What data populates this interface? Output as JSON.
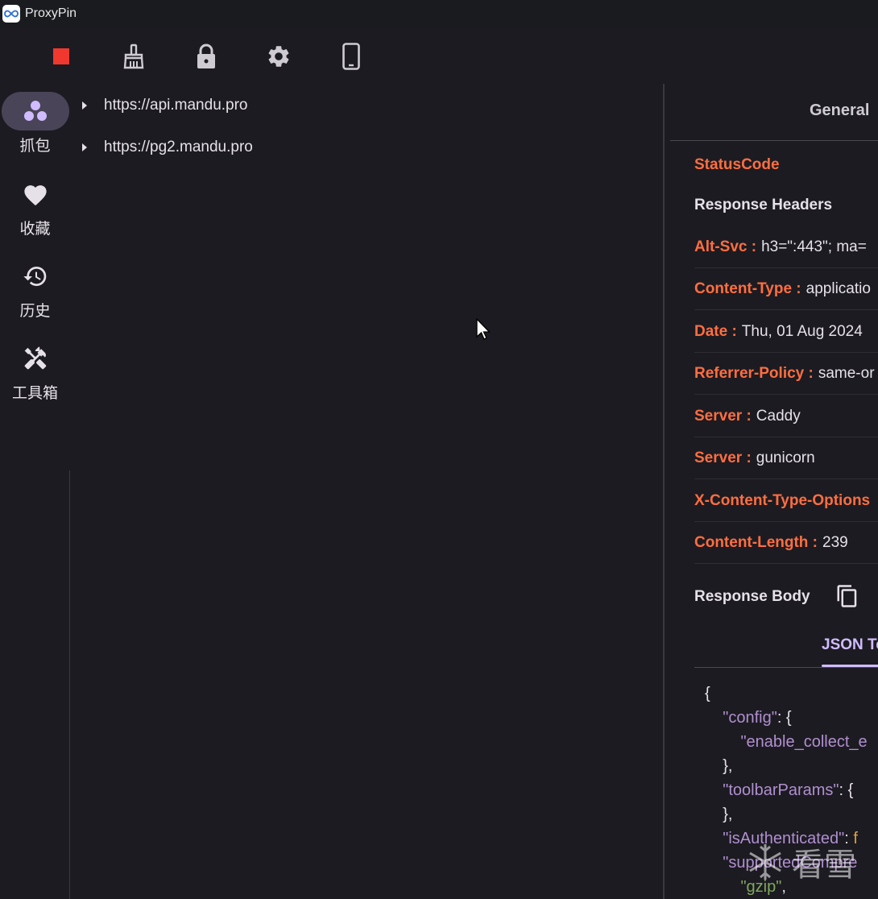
{
  "app": {
    "title": "ProxyPin"
  },
  "toolbar": {
    "icons": [
      "stop-icon",
      "clean-icon",
      "lock-icon",
      "gear-icon",
      "phone-icon"
    ],
    "stop_color": "#f1382f"
  },
  "nav": {
    "items": [
      {
        "label": "抓包",
        "icon": "capture-icon",
        "active": true
      },
      {
        "label": "收藏",
        "icon": "heart-icon",
        "active": false
      },
      {
        "label": "历史",
        "icon": "history-icon",
        "active": false
      },
      {
        "label": "工具箱",
        "icon": "tools-icon",
        "active": false
      }
    ]
  },
  "domains": [
    {
      "url": "https://api.mandu.pro"
    },
    {
      "url": "https://pg2.mandu.pro"
    }
  ],
  "detail": {
    "tab_general": "General",
    "status_code_label": "StatusCode",
    "response_headers_title": "Response Headers",
    "headers": [
      {
        "key": "Alt-Svc :",
        "value": "h3=\":443\"; ma="
      },
      {
        "key": "Content-Type :",
        "value": "applicatio"
      },
      {
        "key": "Date :",
        "value": "Thu, 01 Aug 2024"
      },
      {
        "key": "Referrer-Policy :",
        "value": "same-or"
      },
      {
        "key": "Server :",
        "value": "Caddy"
      },
      {
        "key": "Server :",
        "value": "gunicorn"
      },
      {
        "key": "X-Content-Type-Options",
        "value": ""
      },
      {
        "key": "Content-Length :",
        "value": "239"
      }
    ],
    "response_body_title": "Response Body",
    "json_tab": "JSON Te",
    "json_lines": {
      "l1": "{",
      "l2_key": "\"config\"",
      "l2_rest": ": {",
      "l3_key": "\"enable_collect_e",
      "l4": "},",
      "l5_key": "\"toolbarParams\"",
      "l5_rest": ": {",
      "l6": "},",
      "l7_key": "\"isAuthenticated\"",
      "l7_rest": ": ",
      "l7_val": "f",
      "l8_key": "\"supportedCompre",
      "l9_val": "\"gzip\"",
      "l9_rest": ","
    },
    "key_color": "#ff6e40",
    "accent_color": "#d0bcff"
  },
  "watermark": {
    "text": "看雪"
  }
}
